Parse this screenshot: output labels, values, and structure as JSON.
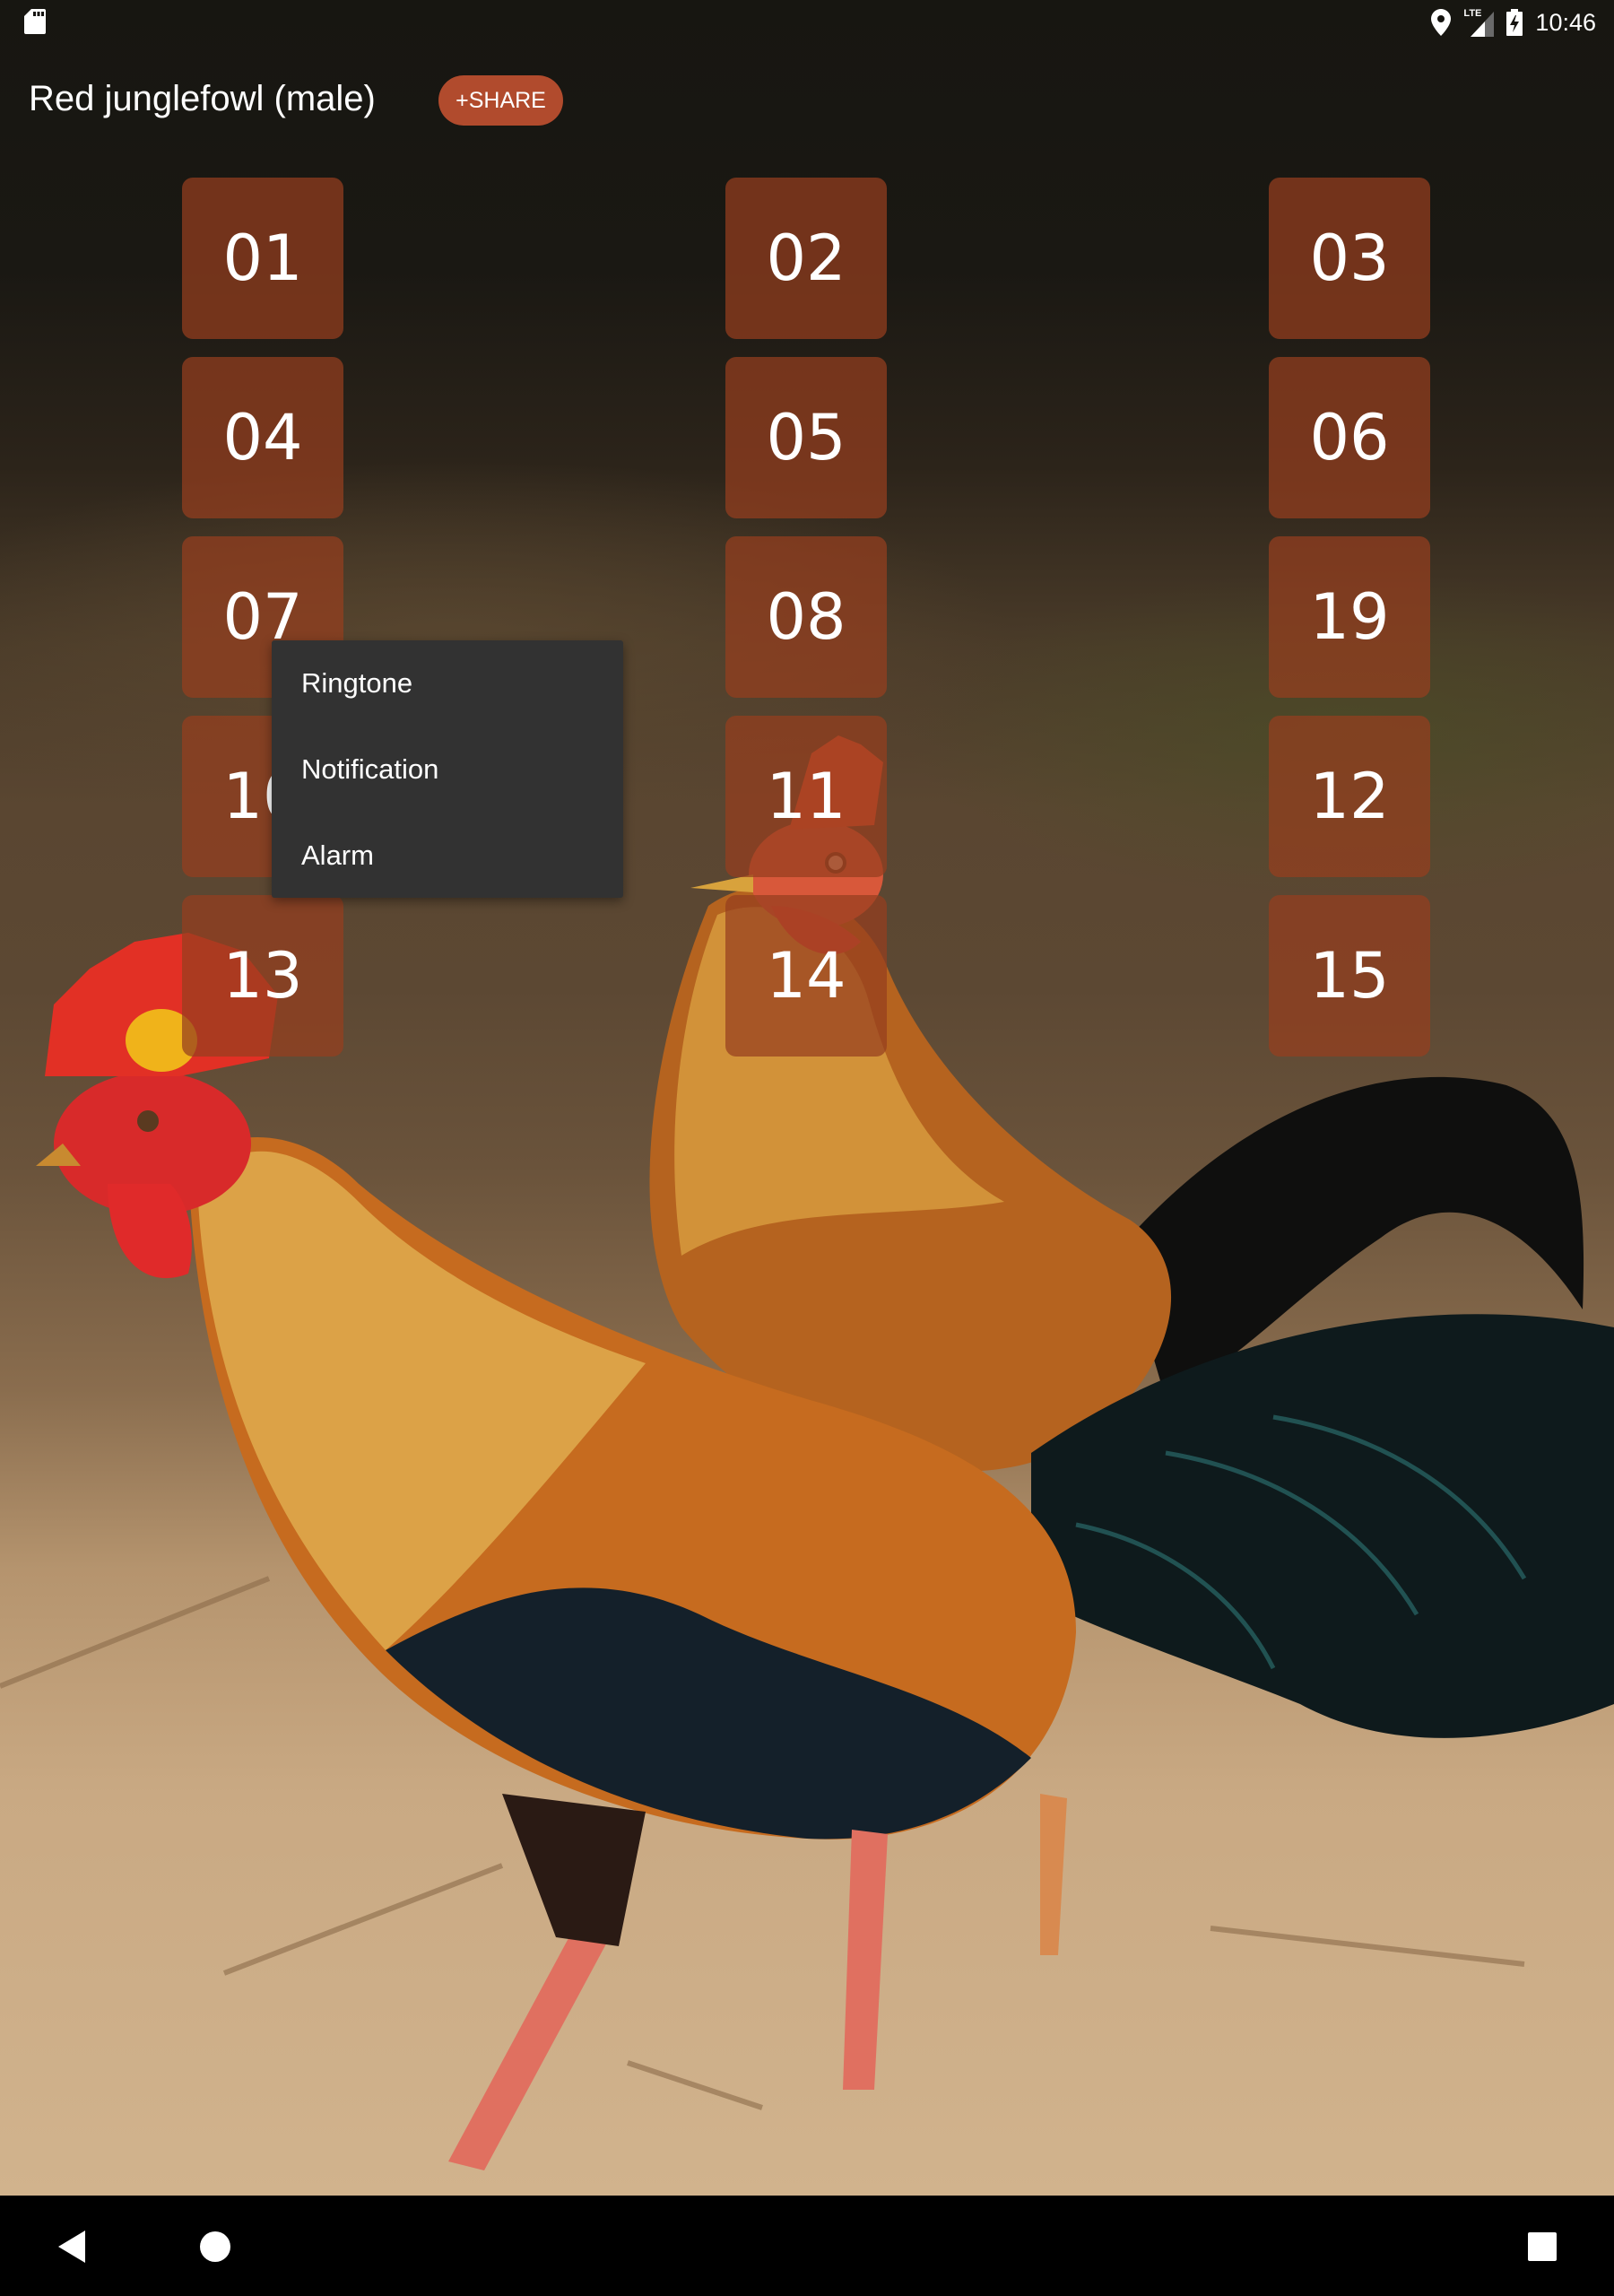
{
  "status_bar": {
    "left_icons": [
      "sd-card-icon"
    ],
    "right_icons": [
      "location-icon",
      "lte-signal-icon",
      "battery-charging-icon"
    ],
    "network_label": "LTE",
    "time": "10:46"
  },
  "app_bar": {
    "title": "Red junglefowl (male)",
    "share_label": "+SHARE"
  },
  "sound_tiles": [
    {
      "label": "01"
    },
    {
      "label": "02"
    },
    {
      "label": "03"
    },
    {
      "label": "04"
    },
    {
      "label": "05"
    },
    {
      "label": "06"
    },
    {
      "label": "07"
    },
    {
      "label": "08"
    },
    {
      "label": "19"
    },
    {
      "label": "10"
    },
    {
      "label": "11"
    },
    {
      "label": "12"
    },
    {
      "label": "13"
    },
    {
      "label": "14"
    },
    {
      "label": "15"
    }
  ],
  "context_menu": {
    "items": [
      {
        "label": "Ringtone"
      },
      {
        "label": "Notification"
      },
      {
        "label": "Alarm"
      }
    ]
  },
  "nav_bar": {
    "buttons": [
      "back-icon",
      "home-icon",
      "recents-icon"
    ]
  },
  "colors": {
    "tile": "#963e1e",
    "share_button": "#b14b2d",
    "menu_background": "#323232",
    "status_bar": "#15130f",
    "nav_bar": "#000000"
  }
}
